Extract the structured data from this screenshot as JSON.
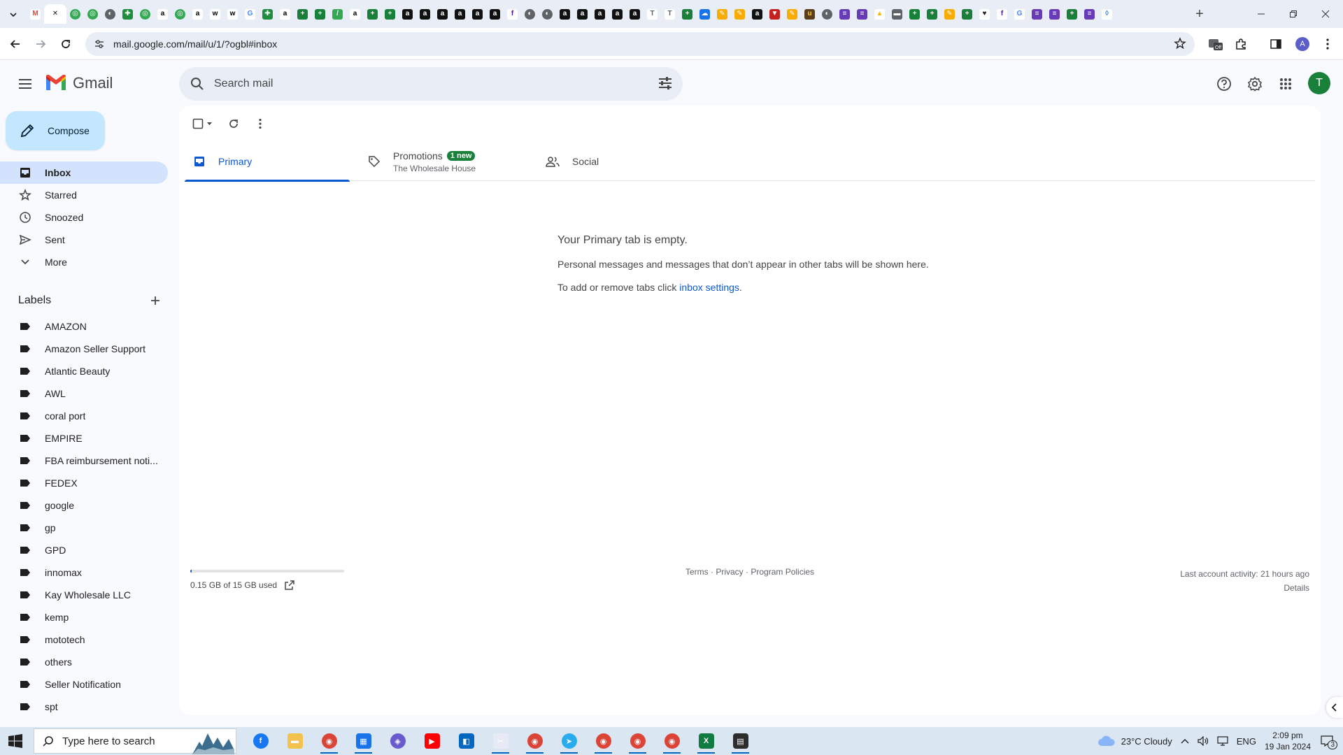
{
  "browser": {
    "url": "mail.google.com/mail/u/1/?ogbl#inbox",
    "profile_initial": "A",
    "tab_favicons": [
      {
        "icon": "gmail-icon",
        "bg": "#ffffff",
        "fg": "#ea4335",
        "glyph": "M"
      },
      {
        "icon": "close-icon",
        "bg": "#ffffff",
        "fg": "#1f1f1f",
        "glyph": "✕",
        "active": true
      },
      {
        "icon": "green-circle-icon",
        "bg": "#34a853",
        "fg": "#ffffff",
        "glyph": "◎",
        "round": true
      },
      {
        "icon": "green-circle-icon",
        "bg": "#34a853",
        "fg": "#ffffff",
        "glyph": "◎",
        "round": true
      },
      {
        "icon": "globe-icon",
        "bg": "#5f6368",
        "fg": "#ffffff",
        "glyph": "◐",
        "round": true
      },
      {
        "icon": "puzzle-icon",
        "bg": "#1e8e3e",
        "fg": "#ffffff",
        "glyph": "✚"
      },
      {
        "icon": "green-circle-icon",
        "bg": "#34a853",
        "fg": "#ffffff",
        "glyph": "◎",
        "round": true
      },
      {
        "icon": "amazon-icon",
        "bg": "#ffffff",
        "fg": "#000000",
        "glyph": "a"
      },
      {
        "icon": "green-circle-icon",
        "bg": "#34a853",
        "fg": "#ffffff",
        "glyph": "◎",
        "round": true
      },
      {
        "icon": "amazon-icon",
        "bg": "#ffffff",
        "fg": "#000000",
        "glyph": "a"
      },
      {
        "icon": "wix-icon",
        "bg": "#ffffff",
        "fg": "#000000",
        "glyph": "w"
      },
      {
        "icon": "wix-icon",
        "bg": "#ffffff",
        "fg": "#000000",
        "glyph": "w"
      },
      {
        "icon": "google-icon",
        "bg": "#ffffff",
        "fg": "#4285f4",
        "glyph": "G"
      },
      {
        "icon": "puzzle-icon",
        "bg": "#1e8e3e",
        "fg": "#ffffff",
        "glyph": "✚"
      },
      {
        "icon": "amazon-icon",
        "bg": "#ffffff",
        "fg": "#000000",
        "glyph": "a"
      },
      {
        "icon": "sheets-icon",
        "bg": "#188038",
        "fg": "#ffffff",
        "glyph": "+"
      },
      {
        "icon": "sheets-icon",
        "bg": "#188038",
        "fg": "#ffffff",
        "glyph": "+"
      },
      {
        "icon": "script-icon",
        "bg": "#34a853",
        "fg": "#ffffff",
        "glyph": "/"
      },
      {
        "icon": "amazon-icon",
        "bg": "#ffffff",
        "fg": "#000000",
        "glyph": "a"
      },
      {
        "icon": "sheets-icon",
        "bg": "#188038",
        "fg": "#ffffff",
        "glyph": "+"
      },
      {
        "icon": "sheets-icon",
        "bg": "#188038",
        "fg": "#ffffff",
        "glyph": "+"
      },
      {
        "icon": "amazon-box-icon",
        "bg": "#111111",
        "fg": "#ffffff",
        "glyph": "a"
      },
      {
        "icon": "amazon-box-icon",
        "bg": "#111111",
        "fg": "#ffffff",
        "glyph": "a"
      },
      {
        "icon": "amazon-box-icon",
        "bg": "#111111",
        "fg": "#ffffff",
        "glyph": "a"
      },
      {
        "icon": "amazon-box-icon",
        "bg": "#111111",
        "fg": "#ffffff",
        "glyph": "a"
      },
      {
        "icon": "amazon-box-icon",
        "bg": "#111111",
        "fg": "#ffffff",
        "glyph": "a"
      },
      {
        "icon": "amazon-box-icon",
        "bg": "#111111",
        "fg": "#ffffff",
        "glyph": "a"
      },
      {
        "icon": "fedex-icon",
        "bg": "#ffffff",
        "fg": "#4d148c",
        "glyph": "f"
      },
      {
        "icon": "globe-icon",
        "bg": "#5f6368",
        "fg": "#ffffff",
        "glyph": "◐",
        "round": true
      },
      {
        "icon": "globe-icon",
        "bg": "#5f6368",
        "fg": "#ffffff",
        "glyph": "◐",
        "round": true
      },
      {
        "icon": "amazon-box-icon",
        "bg": "#111111",
        "fg": "#ffffff",
        "glyph": "a"
      },
      {
        "icon": "amazon-box-icon",
        "bg": "#111111",
        "fg": "#ffffff",
        "glyph": "a"
      },
      {
        "icon": "amazon-box-icon",
        "bg": "#111111",
        "fg": "#ffffff",
        "glyph": "a"
      },
      {
        "icon": "amazon-box-icon",
        "bg": "#111111",
        "fg": "#ffffff",
        "glyph": "a"
      },
      {
        "icon": "amazon-box-icon",
        "bg": "#111111",
        "fg": "#ffffff",
        "glyph": "a"
      },
      {
        "icon": "script-icon",
        "bg": "#ffffff",
        "fg": "#5f6368",
        "glyph": "T"
      },
      {
        "icon": "script-icon",
        "bg": "#ffffff",
        "fg": "#5f6368",
        "glyph": "T"
      },
      {
        "icon": "sheets-icon",
        "bg": "#188038",
        "fg": "#ffffff",
        "glyph": "+"
      },
      {
        "icon": "cloud-icon",
        "bg": "#1a73e8",
        "fg": "#ffffff",
        "glyph": "☁"
      },
      {
        "icon": "pen-icon",
        "bg": "#f9ab00",
        "fg": "#ffffff",
        "glyph": "✎"
      },
      {
        "icon": "pen-icon",
        "bg": "#f9ab00",
        "fg": "#ffffff",
        "glyph": "✎"
      },
      {
        "icon": "amazon-box-icon",
        "bg": "#111111",
        "fg": "#ffffff",
        "glyph": "a"
      },
      {
        "icon": "shield-icon",
        "bg": "#c5221f",
        "fg": "#ffffff",
        "glyph": "▼"
      },
      {
        "icon": "pen-icon",
        "bg": "#f9ab00",
        "fg": "#ffffff",
        "glyph": "✎"
      },
      {
        "icon": "ups-icon",
        "bg": "#5a3e1b",
        "fg": "#ffd200",
        "glyph": "u"
      },
      {
        "icon": "globe-icon",
        "bg": "#5f6368",
        "fg": "#ffffff",
        "glyph": "◐",
        "round": true
      },
      {
        "icon": "forms-icon",
        "bg": "#673ab7",
        "fg": "#ffffff",
        "glyph": "≡"
      },
      {
        "icon": "forms-icon",
        "bg": "#673ab7",
        "fg": "#ffffff",
        "glyph": "≡"
      },
      {
        "icon": "drive-icon",
        "bg": "#ffffff",
        "fg": "#fbbc04",
        "glyph": "▲"
      },
      {
        "icon": "bar-icon",
        "bg": "#5f6368",
        "fg": "#ffffff",
        "glyph": "▬"
      },
      {
        "icon": "sheets-icon",
        "bg": "#188038",
        "fg": "#ffffff",
        "glyph": "+"
      },
      {
        "icon": "sheets-icon",
        "bg": "#188038",
        "fg": "#ffffff",
        "glyph": "+"
      },
      {
        "icon": "pen-icon",
        "bg": "#f9ab00",
        "fg": "#ffffff",
        "glyph": "✎"
      },
      {
        "icon": "sheets-icon",
        "bg": "#188038",
        "fg": "#ffffff",
        "glyph": "+"
      },
      {
        "icon": "heart-icon",
        "bg": "#ffffff",
        "fg": "#1f1f1f",
        "glyph": "♥"
      },
      {
        "icon": "fedex-icon",
        "bg": "#ffffff",
        "fg": "#4d148c",
        "glyph": "f"
      },
      {
        "icon": "google-icon",
        "bg": "#ffffff",
        "fg": "#4285f4",
        "glyph": "G"
      },
      {
        "icon": "forms-icon",
        "bg": "#673ab7",
        "fg": "#ffffff",
        "glyph": "≡"
      },
      {
        "icon": "forms-icon",
        "bg": "#673ab7",
        "fg": "#ffffff",
        "glyph": "≡"
      },
      {
        "icon": "sheets-icon",
        "bg": "#188038",
        "fg": "#ffffff",
        "glyph": "+"
      },
      {
        "icon": "forms-icon",
        "bg": "#673ab7",
        "fg": "#ffffff",
        "glyph": "≡"
      },
      {
        "icon": "drop-icon",
        "bg": "#ffffff",
        "fg": "#1a73e8",
        "glyph": "◊"
      }
    ]
  },
  "gmail": {
    "logo_text": "Gmail",
    "search_placeholder": "Search mail",
    "avatar_initial": "T",
    "compose_label": "Compose",
    "nav": [
      {
        "label": "Inbox",
        "icon": "inbox-icon",
        "active": true
      },
      {
        "label": "Starred",
        "icon": "star-icon"
      },
      {
        "label": "Snoozed",
        "icon": "clock-icon"
      },
      {
        "label": "Sent",
        "icon": "send-icon"
      },
      {
        "label": "More",
        "icon": "chevron-down-icon"
      }
    ],
    "labels_title": "Labels",
    "labels": [
      "AMAZON",
      "Amazon Seller Support",
      "Atlantic Beauty",
      "AWL",
      "coral port",
      "EMPIRE",
      "FBA reimbursement noti...",
      "FEDEX",
      "google",
      "gp",
      "GPD",
      "innomax",
      "Kay Wholesale LLC",
      "kemp",
      "mototech",
      "others",
      "Seller Notification",
      "spt"
    ],
    "tabs": {
      "primary": "Primary",
      "promotions": "Promotions",
      "promotions_badge": "1 new",
      "promotions_sub": "The Wholesale House",
      "social": "Social"
    },
    "empty": {
      "title": "Your Primary tab is empty.",
      "line1": "Personal messages and messages that don’t appear in other tabs will be shown here.",
      "line2_prefix": "To add or remove tabs click ",
      "line2_link": "inbox settings",
      "line2_suffix": "."
    },
    "storage": {
      "text": "0.15 GB of 15 GB used",
      "fraction": 0.01
    },
    "footer_links": {
      "terms": "Terms",
      "privacy": "Privacy",
      "policies": "Program Policies"
    },
    "activity": {
      "text": "Last account activity: 21 hours ago",
      "details": "Details"
    }
  },
  "taskbar": {
    "search_placeholder": "Type here to search",
    "apps": [
      {
        "icon": "facebook-icon",
        "bg": "#1877f2",
        "glyph": "f",
        "round": true
      },
      {
        "icon": "folder-icon",
        "bg": "#f2c14e",
        "glyph": "▬"
      },
      {
        "icon": "chrome-icon",
        "bg": "#db4437",
        "glyph": "◉",
        "round": true,
        "running": true
      },
      {
        "icon": "calculator-icon",
        "bg": "#1a73e8",
        "glyph": "▦",
        "running": true
      },
      {
        "icon": "copilot-icon",
        "bg": "#6a5acd",
        "glyph": "◈",
        "round": true
      },
      {
        "icon": "youtube-icon",
        "bg": "#ff0000",
        "glyph": "▶"
      },
      {
        "icon": "store-icon",
        "bg": "#0067c0",
        "glyph": "◧"
      },
      {
        "icon": "snip-icon",
        "bg": "#e8eaf6",
        "glyph": "✂",
        "running": true
      },
      {
        "icon": "chrome-icon",
        "bg": "#db4437",
        "glyph": "◉",
        "round": true,
        "running": true
      },
      {
        "icon": "telegram-icon",
        "bg": "#2aabee",
        "glyph": "➤",
        "round": true,
        "running": true
      },
      {
        "icon": "chrome-icon",
        "bg": "#db4437",
        "glyph": "◉",
        "round": true,
        "running": true
      },
      {
        "icon": "chrome-icon",
        "bg": "#db4437",
        "glyph": "◉",
        "round": true,
        "running": true
      },
      {
        "icon": "chrome-icon",
        "bg": "#db4437",
        "glyph": "◉",
        "round": true,
        "running": true
      },
      {
        "icon": "excel-icon",
        "bg": "#107c41",
        "glyph": "X",
        "running": true
      },
      {
        "icon": "notes-icon",
        "bg": "#2d2d2d",
        "glyph": "▤",
        "running": true
      }
    ],
    "weather": "23°C  Cloudy",
    "lang": "ENG",
    "time": "2:09 pm",
    "date": "19 Jan 2024",
    "notif_count": "3"
  }
}
